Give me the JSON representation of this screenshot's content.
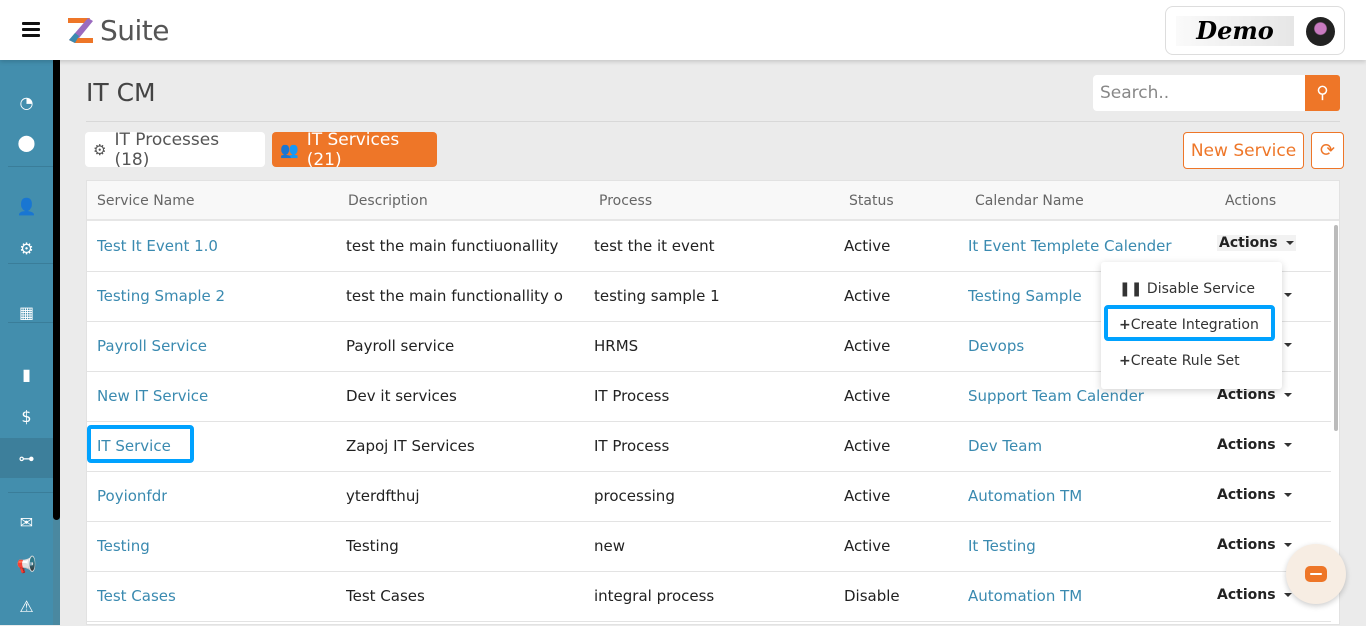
{
  "app": {
    "brand": "Suite",
    "brand_letter": "Z",
    "profile_name": "Demo"
  },
  "colors": {
    "accent": "#ee7628",
    "sidebar": "#438ead",
    "link": "#3a8ab0",
    "highlight": "#00a2ff"
  },
  "page": {
    "title": "IT CM",
    "search_placeholder": "Search.."
  },
  "tabs": [
    {
      "label": "IT Processes (18)",
      "icon": "gears-icon"
    },
    {
      "label": "IT Services (21)",
      "icon": "users-cog-icon",
      "active": true
    }
  ],
  "toolbar": {
    "new_label": "New Service"
  },
  "sidebar": [
    "dashboard-icon",
    "map-pin-icon",
    "user-tag-icon",
    "users-cog-icon",
    "calendar-icon",
    "address-book-icon",
    "hand-dollar-icon",
    "sitemap-icon",
    "envelope-icon",
    "megaphone-icon",
    "warning-icon"
  ],
  "table": {
    "headers": [
      "Service Name",
      "Description",
      "Process",
      "Status",
      "Calendar Name",
      "Actions"
    ],
    "rows": [
      [
        "Test It Event 1.0",
        "test the main functiuonallity",
        "test the it event",
        "Active",
        "It Event Templete Calender",
        "Actions"
      ],
      [
        "Testing Smaple 2",
        "test the main functionallity o",
        "testing sample 1",
        "Active",
        "Testing Sample",
        "Actions"
      ],
      [
        "Payroll Service",
        "Payroll service",
        "HRMS",
        "Active",
        "Devops",
        "Actions"
      ],
      [
        "New IT Service",
        "Dev it services",
        "IT Process",
        "Active",
        "Support Team Calender",
        "Actions"
      ],
      [
        "IT Service",
        "Zapoj IT Services",
        "IT Process",
        "Active",
        "Dev Team",
        "Actions"
      ],
      [
        "Poyionfdr",
        "yterdfthuj",
        "processing",
        "Active",
        "Automation TM",
        "Actions"
      ],
      [
        "Testing",
        "Testing",
        "new",
        "Active",
        "It Testing",
        "Actions"
      ],
      [
        "Test Cases",
        "Test Cases",
        "integral process",
        "Disable",
        "Automation TM",
        "Actions"
      ]
    ]
  },
  "dropdown": [
    "Disable Service",
    "Create Integration",
    "Create Rule Set"
  ]
}
